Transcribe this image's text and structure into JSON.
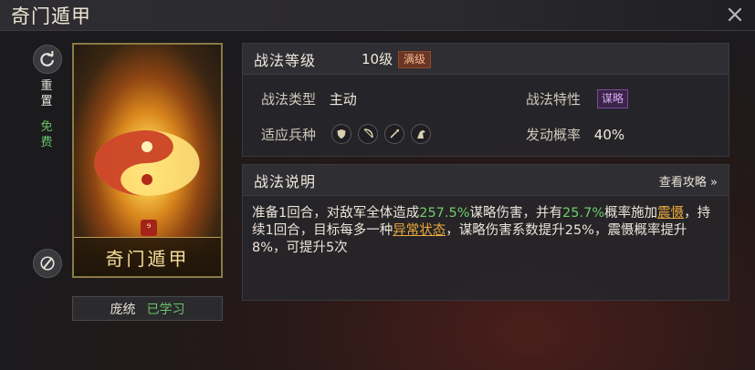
{
  "window": {
    "title": "奇门遁甲"
  },
  "side": {
    "reset_top": "重",
    "reset_bottom": "置",
    "free_top": "免",
    "free_bottom": "费"
  },
  "card": {
    "name": "奇门遁甲",
    "badge": "⁹"
  },
  "learned": {
    "general": "庞统",
    "status": "已学习"
  },
  "info": {
    "title": "战法等级",
    "level": "10级",
    "max_tag": "满级",
    "type_label": "战法类型",
    "type_value": "主动",
    "trait_label": "战法特性",
    "trait_value": "谋略",
    "troop_label": "适应兵种",
    "troops": [
      "shield-icon",
      "bow-icon",
      "spear-icon",
      "horse-icon"
    ],
    "prob_label": "发动概率",
    "prob_value": "40%"
  },
  "desc": {
    "title": "战法说明",
    "guide": "查看攻略 »",
    "t1": "准备1回合，对敌军全体造成",
    "v1": "257.5%",
    "t2": "谋略伤害，并有",
    "v2": "25.7%",
    "t3": "概率施加",
    "v3": "震慑",
    "t4": "，持续1回合，目标每多一种",
    "v4": "异常状态",
    "t5": "，谋略伤害系数提升25%，震慑概率提升8%，可提升5次"
  },
  "colors": {
    "accent_green": "#6ccf6a",
    "accent_orange": "#e8a83c",
    "trait_purple": "#d5a6f2"
  }
}
